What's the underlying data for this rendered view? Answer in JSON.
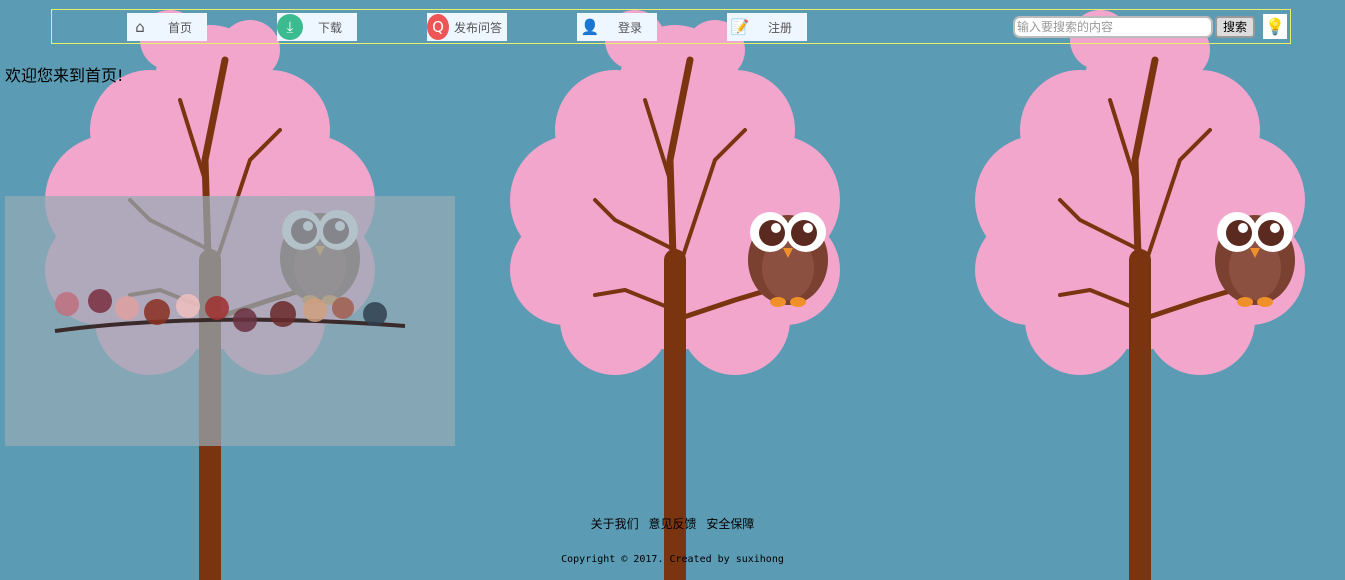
{
  "nav": {
    "items": [
      {
        "label": "首页",
        "icon": "home-icon"
      },
      {
        "label": "下载",
        "icon": "download-icon"
      },
      {
        "label": "发布问答",
        "icon": "qa-icon"
      },
      {
        "label": "登录",
        "icon": "user-icon"
      },
      {
        "label": "注册",
        "icon": "register-icon"
      }
    ],
    "search_placeholder": "输入要搜索的内容",
    "search_button": "搜索"
  },
  "main": {
    "welcome": "欢迎您来到首页!"
  },
  "footer": {
    "links": [
      "关于我们",
      "意见反馈",
      "安全保障"
    ],
    "copyright": "Copyright © 2017. Created by suxihong"
  },
  "colors": {
    "background": "#5b9bb3",
    "blossom": "#f2a6cc",
    "trunk": "#7a3510",
    "owl": "#7a4030"
  }
}
